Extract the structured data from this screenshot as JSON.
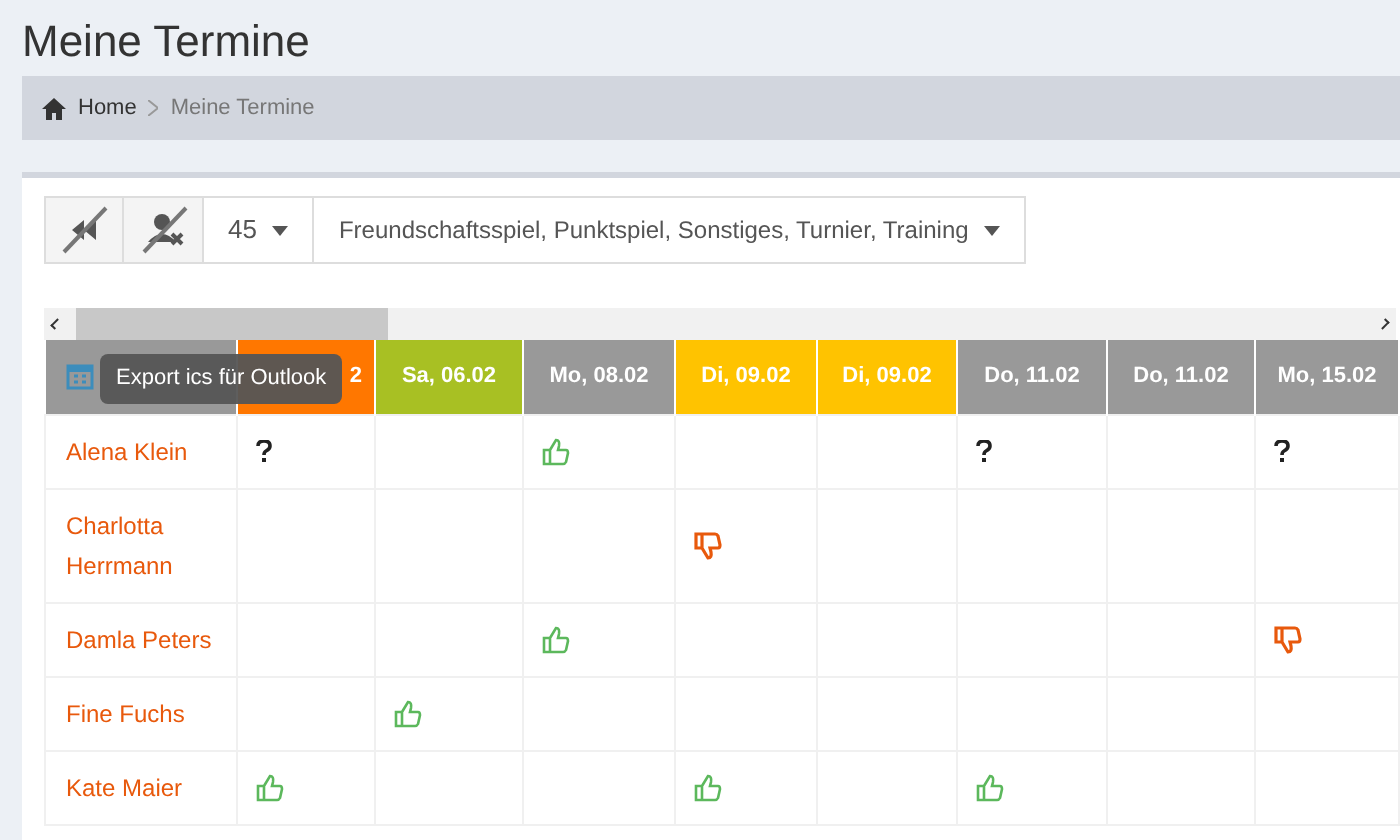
{
  "title": "Meine Termine",
  "breadcrumb": [
    {
      "label": "Home"
    },
    {
      "label": "Meine Termine"
    }
  ],
  "toolbar": {
    "count": "45",
    "filter": "Freundschaftsspiel, Punktspiel, Sonstiges, Turnier, Training"
  },
  "tooltip": "Export ics für Outlook",
  "columns": [
    {
      "label": "2",
      "color": "#ff7700"
    },
    {
      "label": "Sa, 06.02",
      "color": "#a8c023"
    },
    {
      "label": "Mo, 08.02",
      "color": "#999999"
    },
    {
      "label": "Di, 09.02",
      "color": "#ffc300"
    },
    {
      "label": "Di, 09.02",
      "color": "#ffc300"
    },
    {
      "label": "Do, 11.02",
      "color": "#999999"
    },
    {
      "label": "Do, 11.02",
      "color": "#999999"
    },
    {
      "label": "Mo, 15.02",
      "color": "#999999"
    }
  ],
  "rows": [
    {
      "name": "Alena Klein",
      "cells": [
        {
          "kind": "maybe"
        },
        {
          "kind": "empty"
        },
        {
          "kind": "yes"
        },
        {
          "kind": "empty"
        },
        {
          "kind": "empty"
        },
        {
          "kind": "maybe"
        },
        {
          "kind": "empty"
        },
        {
          "kind": "maybe"
        }
      ]
    },
    {
      "name": "Charlotta Herrmann",
      "cells": [
        {
          "kind": "empty"
        },
        {
          "kind": "empty"
        },
        {
          "kind": "empty"
        },
        {
          "kind": "no"
        },
        {
          "kind": "empty"
        },
        {
          "kind": "empty"
        },
        {
          "kind": "empty"
        },
        {
          "kind": "empty"
        }
      ]
    },
    {
      "name": "Damla Peters",
      "cells": [
        {
          "kind": "empty"
        },
        {
          "kind": "empty"
        },
        {
          "kind": "yes"
        },
        {
          "kind": "empty"
        },
        {
          "kind": "empty"
        },
        {
          "kind": "empty"
        },
        {
          "kind": "empty"
        },
        {
          "kind": "no"
        }
      ]
    },
    {
      "name": "Fine Fuchs",
      "cells": [
        {
          "kind": "empty"
        },
        {
          "kind": "yes"
        },
        {
          "kind": "empty"
        },
        {
          "kind": "empty"
        },
        {
          "kind": "empty"
        },
        {
          "kind": "empty"
        },
        {
          "kind": "empty"
        },
        {
          "kind": "empty"
        }
      ]
    },
    {
      "name": "Kate Maier",
      "cells": [
        {
          "kind": "yes"
        },
        {
          "kind": "empty"
        },
        {
          "kind": "empty"
        },
        {
          "kind": "yes"
        },
        {
          "kind": "empty"
        },
        {
          "kind": "yes"
        },
        {
          "kind": "empty"
        },
        {
          "kind": "empty"
        }
      ]
    }
  ]
}
